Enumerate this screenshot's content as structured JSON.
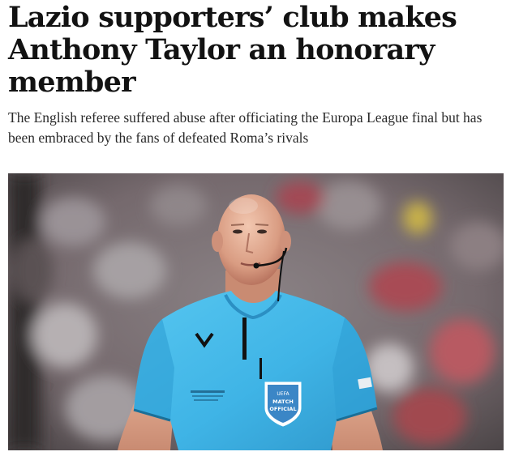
{
  "article": {
    "headline_lines": [
      "Lazio supporters’ club makes",
      "Anthony Taylor an honorary",
      "member"
    ],
    "standfirst_lines": [
      "The English referee suffered abuse after officiating the Europa League final but has",
      "been embraced by the fans of defeated Roma’s rivals"
    ]
  },
  "photo": {
    "subject": "referee-photo",
    "shirt_badge_lines": [
      "UEFA",
      "MATCH",
      "OFFICIAL"
    ],
    "colors": {
      "shirt": "#3fb4e6",
      "crowd_red": "#a84b55",
      "crowd_grey": "#8e8a8c"
    }
  }
}
